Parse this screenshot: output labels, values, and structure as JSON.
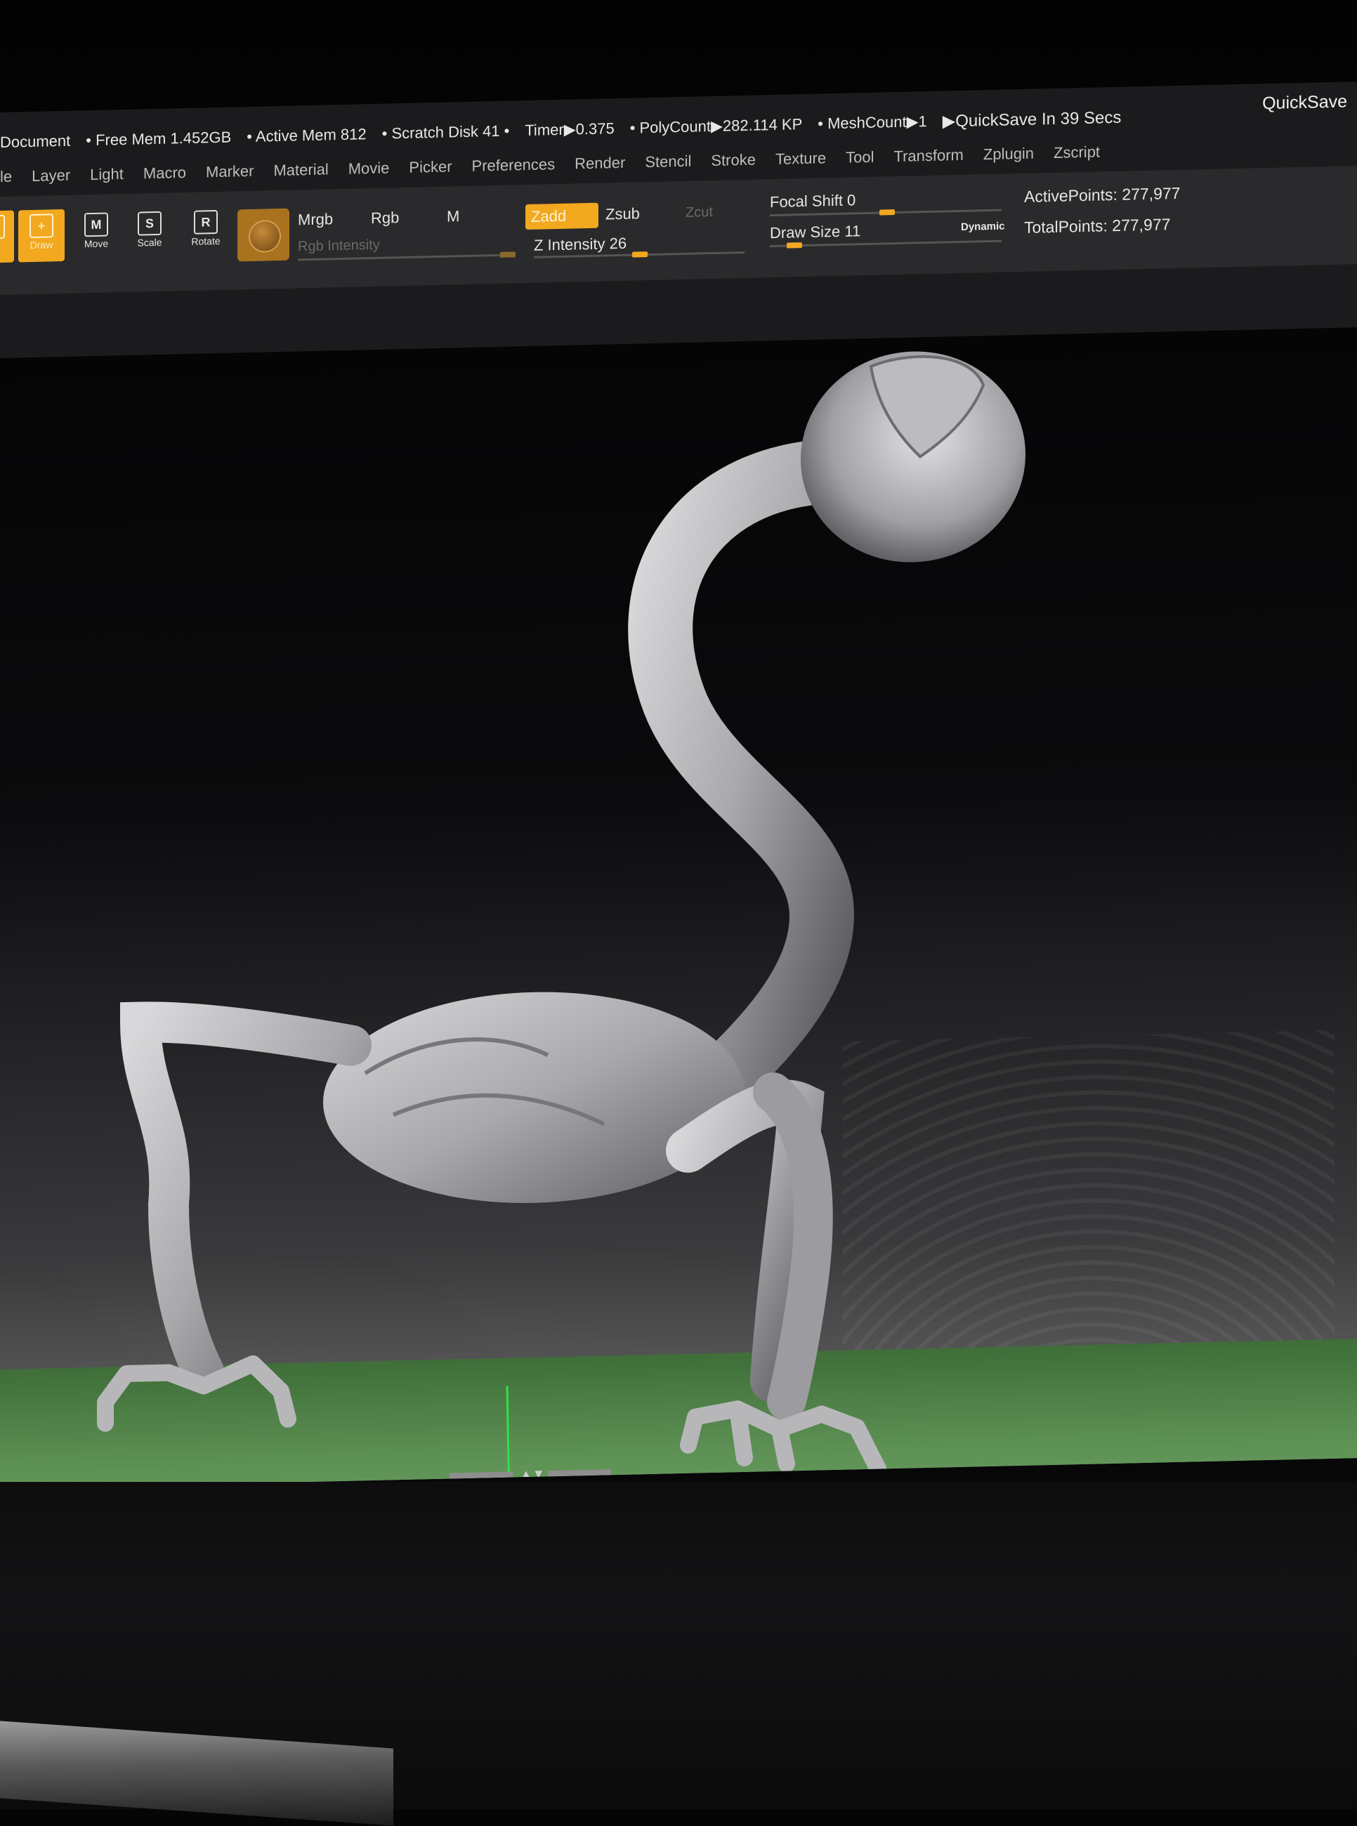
{
  "status_bar": {
    "document": "Document",
    "free_mem": "• Free Mem 1.452GB",
    "active_mem": "• Active Mem 812",
    "scratch_disk": "• Scratch Disk 41 •",
    "timer": "Timer▶0.375",
    "polycount": "• PolyCount▶282.114 KP",
    "meshcount": "• MeshCount▶1",
    "quicksave_timer": "▶QuickSave In 39 Secs",
    "quicksave_button": "QuickSave"
  },
  "menu": [
    "le",
    "Layer",
    "Light",
    "Macro",
    "Marker",
    "Material",
    "Movie",
    "Picker",
    "Preferences",
    "Render",
    "Stencil",
    "Stroke",
    "Texture",
    "Tool",
    "Transform",
    "Zplugin",
    "Zscript"
  ],
  "toolbar": {
    "draw": "Draw",
    "move": "Move",
    "scale": "Scale",
    "rotate": "Rotate",
    "move_glyph": "M",
    "scale_glyph": "S",
    "rotate_glyph": "R",
    "mrgb": "Mrgb",
    "rgb": "Rgb",
    "m": "M",
    "rgb_intensity": "Rgb Intensity",
    "zadd": "Zadd",
    "zsub": "Zsub",
    "zcut": "Zcut",
    "z_intensity": "Z Intensity 26",
    "focal_shift": "Focal Shift 0",
    "draw_size": "Draw Size 11",
    "dynamic": "Dynamic",
    "active_points": "ActivePoints: 277,977",
    "total_points": "TotalPoints: 277,977"
  },
  "colors": {
    "accent": "#f2a81f",
    "background": "#1b1b1d",
    "floor": "#5f9356",
    "model": "#b5b5b8"
  }
}
